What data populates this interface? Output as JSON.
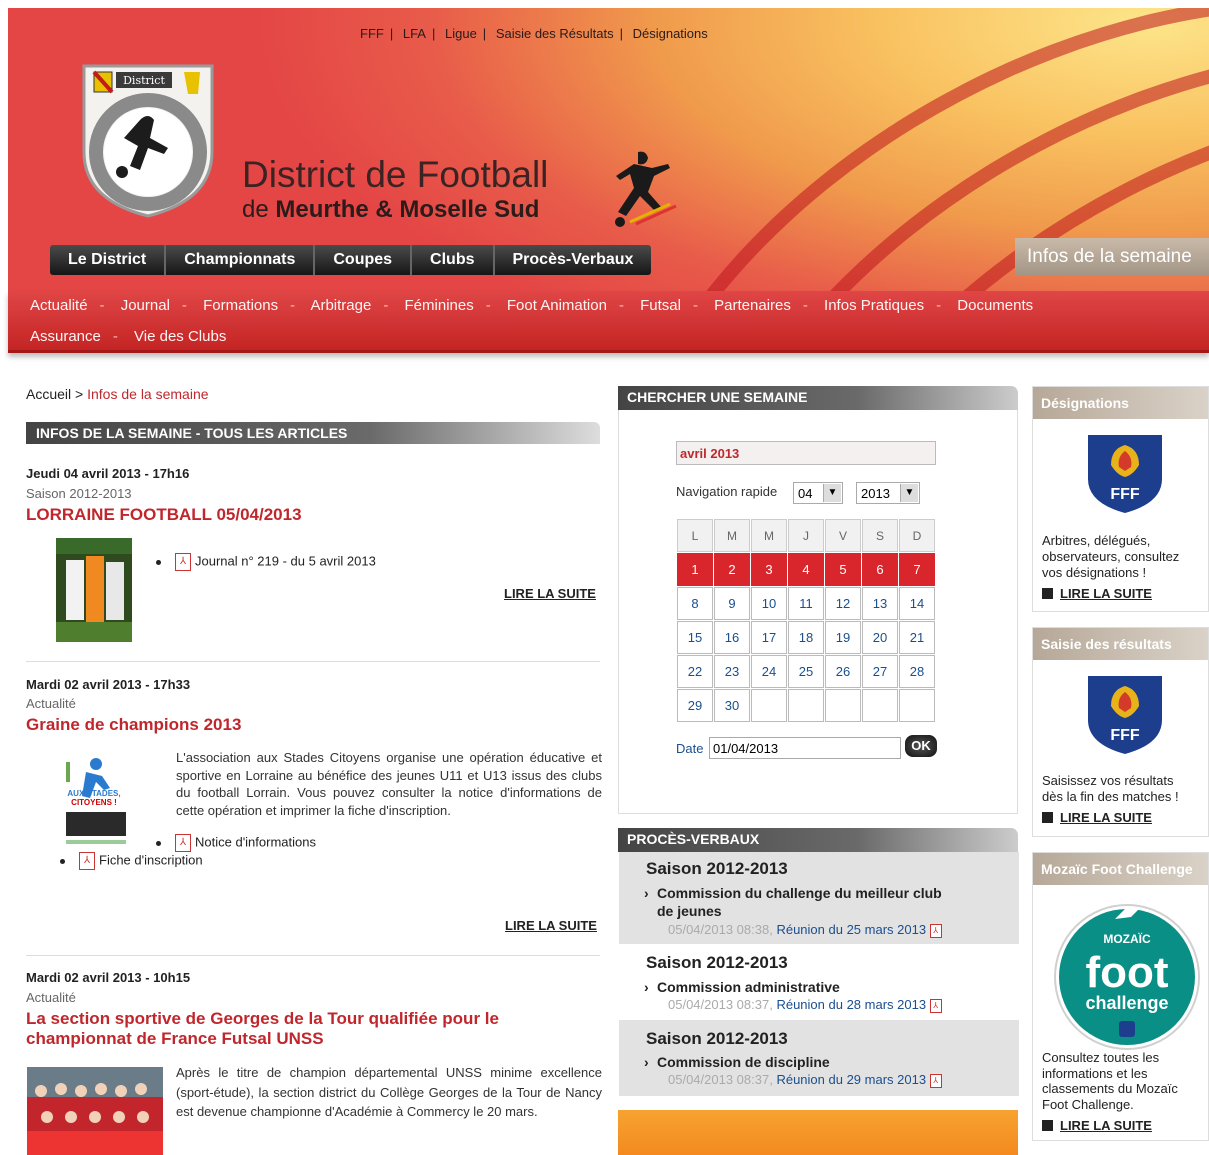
{
  "top_links": [
    "FFF",
    "LFA",
    "Ligue",
    "Saisie des Résultats",
    "Désignations"
  ],
  "brand": {
    "crest_text": "District",
    "crest_ring": "Meurthe et Moselle Sud",
    "title": "District de Football",
    "subtitle_prefix": "de",
    "subtitle_bold": "Meurthe & Moselle Sud"
  },
  "main_nav": [
    "Le District",
    "Championnats",
    "Coupes",
    "Clubs",
    "Procès-Verbaux"
  ],
  "infos_tab": "Infos de la semaine",
  "sub_nav": {
    "row1": [
      "Actualité",
      "Journal",
      "Formations",
      "Arbitrage",
      "Féminines",
      "Foot Animation",
      "Futsal",
      "Partenaires",
      "Infos Pratiques",
      "Documents"
    ],
    "row2": [
      "Assurance",
      "Vie des Clubs"
    ]
  },
  "breadcrumb": {
    "home": "Accueil",
    "sep": ">",
    "current": "Infos de la semaine"
  },
  "section_title": "INFOS DE LA SEMAINE - TOUS LES ARTICLES",
  "articles": [
    {
      "date": "Jeudi 04 avril 2013 - 17h16",
      "category": "Saison 2012-2013",
      "title": "LORRAINE FOOTBALL 05/04/2013",
      "attachments": [
        "Journal n° 219 - du 5 avril 2013"
      ],
      "read_more": "LIRE LA SUITE"
    },
    {
      "date": "Mardi 02 avril 2013 - 17h33",
      "category": "Actualité",
      "title": "Graine de champions 2013",
      "text": "L'association aux Stades Citoyens organise une opération éducative et sportive en Lorraine au bénéfice des jeunes U11 et U13 issus des clubs du football Lorrain. Vous pouvez consulter la notice d'informations de cette opération et imprimer la fiche d'inscription.",
      "thumb_text": "AUX STADES, CITOYENS !",
      "attachments": [
        "Notice d'informations",
        "Fiche d'inscription"
      ],
      "read_more": "LIRE LA SUITE"
    },
    {
      "date": "Mardi 02 avril 2013 - 10h15",
      "category": "Actualité",
      "title_line1": "La section sportive de Georges de la Tour qualifiée pour le",
      "title_line2": "championnat de France Futsal UNSS",
      "text": "Après le titre de champion départemental UNSS minime excellence (sport-étude), la section district du Collège Georges de la Tour de Nancy est devenue championne d'Académie à Commercy le 20 mars."
    }
  ],
  "search_week": {
    "title": "CHERCHER UNE SEMAINE",
    "month_label": "avril 2013",
    "quick_nav_label": "Navigation rapide",
    "month_select": "04",
    "year_select": "2013",
    "weekdays": [
      "L",
      "M",
      "M",
      "J",
      "V",
      "S",
      "D"
    ],
    "weeks": [
      [
        "1",
        "2",
        "3",
        "4",
        "5",
        "6",
        "7"
      ],
      [
        "8",
        "9",
        "10",
        "11",
        "12",
        "13",
        "14"
      ],
      [
        "15",
        "16",
        "17",
        "18",
        "19",
        "20",
        "21"
      ],
      [
        "22",
        "23",
        "24",
        "25",
        "26",
        "27",
        "28"
      ],
      [
        "29",
        "30",
        "",
        "",
        "",
        "",
        ""
      ]
    ],
    "highlighted_week": 0,
    "date_label": "Date",
    "date_value": "01/04/2013",
    "ok_label": "OK"
  },
  "pv": {
    "title": "PROCÈS-VERBAUX",
    "items": [
      {
        "season": "Saison 2012-2013",
        "commission_l1": "Commission du challenge du meilleur club",
        "commission_l2": "de jeunes",
        "timestamp": "05/04/2013 08:38,",
        "meeting": "Réunion du 25 mars 2013"
      },
      {
        "season": "Saison 2012-2013",
        "commission_l1": "Commission administrative",
        "timestamp": "05/04/2013 08:37,",
        "meeting": "Réunion du 28 mars 2013"
      },
      {
        "season": "Saison 2012-2013",
        "commission_l1": "Commission de discipline",
        "timestamp": "05/04/2013 08:37,",
        "meeting": "Réunion du 29 mars 2013"
      }
    ]
  },
  "sidebar": [
    {
      "title": "Désignations",
      "text": [
        "Arbitres, délégués,",
        "observateurs, consultez",
        "vos désignations !"
      ],
      "read_more": "LIRE LA SUITE",
      "logo_text": "FFF"
    },
    {
      "title": "Saisie des résultats",
      "text": [
        "Saisissez vos résultats",
        "dès la fin des matches !"
      ],
      "read_more": "LIRE LA SUITE",
      "logo_text": "FFF"
    },
    {
      "title": "Mozaïc Foot Challenge",
      "text": [
        "Consultez toutes les",
        "informations et les",
        "classements du Mozaïc",
        "Foot Challenge."
      ],
      "read_more": "LIRE LA SUITE",
      "logo_small": "MOZAÏC",
      "logo_big": "foot",
      "logo_sub": "challenge"
    }
  ],
  "colors": {
    "accent_red": "#c0272d",
    "calendar_highlight": "#d9262c",
    "link_blue": "#1a4f8f",
    "header_yellow": "#fde58a",
    "header_red": "#e44545"
  }
}
